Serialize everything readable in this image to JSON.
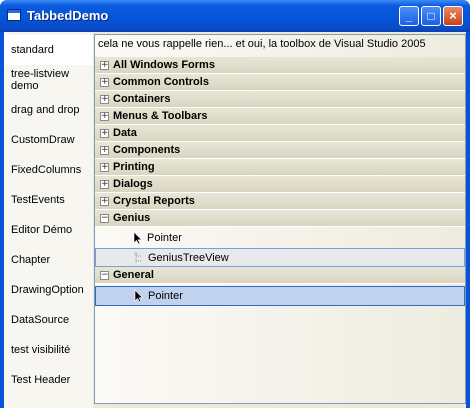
{
  "window": {
    "title": "TabbedDemo",
    "min_label": "_",
    "max_label": "□",
    "close_label": "×"
  },
  "tabs": [
    {
      "label": "standard"
    },
    {
      "label": "tree-listview demo"
    },
    {
      "label": "drag and drop"
    },
    {
      "label": "CustomDraw"
    },
    {
      "label": "FixedColumns"
    },
    {
      "label": "TestEvents"
    },
    {
      "label": "Editor Démo"
    },
    {
      "label": "Chapter"
    },
    {
      "label": "DrawingOption"
    },
    {
      "label": "DataSource"
    },
    {
      "label": "test visibilité"
    },
    {
      "label": "Test Header"
    }
  ],
  "toolbox": {
    "header": "cela ne vous rappelle rien... et oui, la toolbox de Visual Studio 2005",
    "categories": [
      {
        "label": "All Windows Forms",
        "expander": "+"
      },
      {
        "label": "Common Controls",
        "expander": "+"
      },
      {
        "label": "Containers",
        "expander": "+"
      },
      {
        "label": "Menus & Toolbars",
        "expander": "+"
      },
      {
        "label": "Data",
        "expander": "+"
      },
      {
        "label": "Components",
        "expander": "+"
      },
      {
        "label": "Printing",
        "expander": "+"
      },
      {
        "label": "Dialogs",
        "expander": "+"
      },
      {
        "label": "Crystal Reports",
        "expander": "+"
      },
      {
        "label": "Genius",
        "expander": "−"
      }
    ],
    "genius_items": [
      {
        "label": "Pointer",
        "icon": "pointer-icon"
      },
      {
        "label": "GeniusTreeView",
        "icon": "treeview-icon"
      }
    ],
    "general": {
      "label": "General",
      "expander": "−"
    },
    "general_items": [
      {
        "label": "Pointer",
        "icon": "pointer-icon"
      }
    ]
  }
}
